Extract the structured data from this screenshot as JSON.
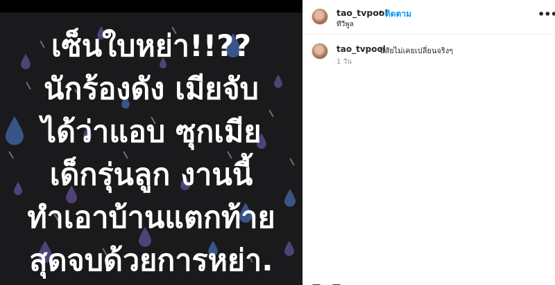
{
  "media": {
    "caption_lines": [
      "เซ็นใบหย่า!!??",
      "นักร้องดัง เมียจับ",
      "ได้ว่าแอบ ซุกเมีย",
      "เด็กรุ่นลูก งานนี้",
      "ทำเอาบ้านแตกท้าย",
      "สุดจบด้วยการหย่า."
    ]
  },
  "header": {
    "username": "tao_tvpool",
    "separator": "•",
    "follow_label": "ติดตาม",
    "location": "ทีวีพูล",
    "more_icon": "more-horizontal-icon"
  },
  "comment": {
    "username": "tao_tvpool",
    "text": "นิสัยไม่เคยเปลี่ยนจริงๆ",
    "time": "1 วัน"
  },
  "colors": {
    "accent": "#0095f6",
    "media_bg": "#1a1a1c",
    "drop": "#5b4a8a",
    "drop_blue": "#3f5f9a"
  }
}
